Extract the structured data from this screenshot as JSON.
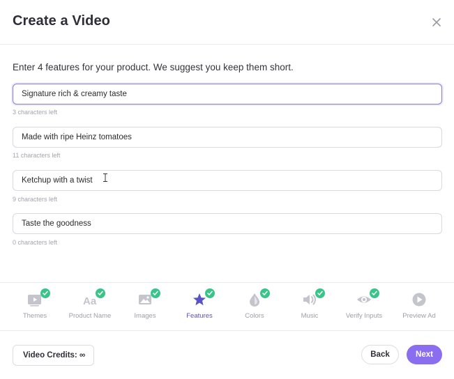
{
  "modal": {
    "title": "Create a Video",
    "intro": "Enter 4 features for your product. We suggest you keep them short."
  },
  "features": [
    {
      "value": "Signature rich & creamy taste",
      "counter": "3 characters left"
    },
    {
      "value": "Made with ripe Heinz tomatoes",
      "counter": "11 characters left"
    },
    {
      "value": "Ketchup with a twist",
      "counter": "9 characters left"
    },
    {
      "value": "Taste the goodness",
      "counter": "0 characters left"
    }
  ],
  "steps": [
    {
      "label": "Themes",
      "icon": "video-icon",
      "completed": true
    },
    {
      "label": "Product Name",
      "icon": "text-aa-icon",
      "completed": true
    },
    {
      "label": "Images",
      "icon": "image-icon",
      "completed": true
    },
    {
      "label": "Features",
      "icon": "star-icon",
      "completed": true,
      "active": true
    },
    {
      "label": "Colors",
      "icon": "color-drop-icon",
      "completed": true
    },
    {
      "label": "Music",
      "icon": "speaker-icon",
      "completed": true
    },
    {
      "label": "Verify Inputs",
      "icon": "eye-icon",
      "completed": true
    },
    {
      "label": "Preview Ad",
      "icon": "play-icon",
      "completed": false
    }
  ],
  "footer": {
    "credits_label": "Video Credits: ∞",
    "back_label": "Back",
    "next_label": "Next"
  },
  "colors": {
    "accent": "#8b6ef0",
    "active_step": "#5a52c9",
    "check": "#3bc48a",
    "inactive_icon": "#c4c4cc"
  }
}
